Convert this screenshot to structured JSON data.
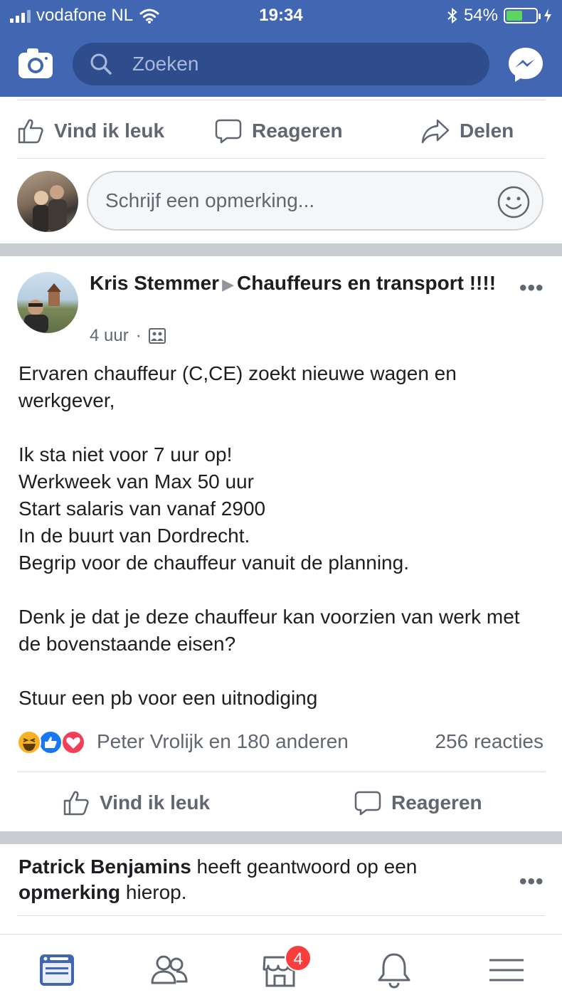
{
  "status_bar": {
    "carrier": "vodafone NL",
    "time": "19:34",
    "battery_text": "54%",
    "battery_level": 0.54
  },
  "header": {
    "search_placeholder": "Zoeken",
    "icons": [
      "camera-icon",
      "search-icon",
      "messenger-icon"
    ]
  },
  "prev_post_actions": {
    "like": "Vind ik leuk",
    "comment": "Reageren",
    "share": "Delen"
  },
  "comment_input": {
    "placeholder": "Schrijf een opmerking..."
  },
  "post": {
    "author": "Kris Stemmer",
    "group": "Chauffeurs en transport !!!!",
    "time": "4 uur",
    "separator": "·",
    "paragraph1": "Ervaren chauffeur (C,CE) zoekt nieuwe wagen en werkgever,",
    "paragraph2": "Ik sta niet voor 7 uur op!\nWerkweek van Max 50 uur\nStart salaris van vanaf 2900\nIn de buurt van Dordrecht.\nBegrip voor de chauffeur vanuit de planning.",
    "paragraph3": "Denk je dat je deze chauffeur kan voorzien van werk met de bovenstaande eisen?",
    "paragraph4": "Stuur een pb voor een uitnodiging",
    "reacted_by": "Peter Vrolijk en 180 anderen",
    "comment_count": "256 reacties",
    "reaction_icons": [
      "haha-icon",
      "like-icon",
      "love-icon"
    ],
    "like_label": "Vind ik leuk",
    "comment_label": "Reageren"
  },
  "notice": {
    "name": "Patrick Benjamins",
    "text_mid": " heeft geantwoord op een ",
    "bold_word": "opmerking",
    "text_end": " hierop."
  },
  "bottom_nav": {
    "items": [
      "news-feed-icon",
      "friends-icon",
      "marketplace-icon",
      "notifications-icon",
      "menu-icon"
    ],
    "badge": "4"
  },
  "colors": {
    "brand": "#4267b2",
    "active_tab": "#4267b2",
    "badge": "#fa3e3e",
    "love": "#f33e58",
    "haha": "#f7b125"
  }
}
